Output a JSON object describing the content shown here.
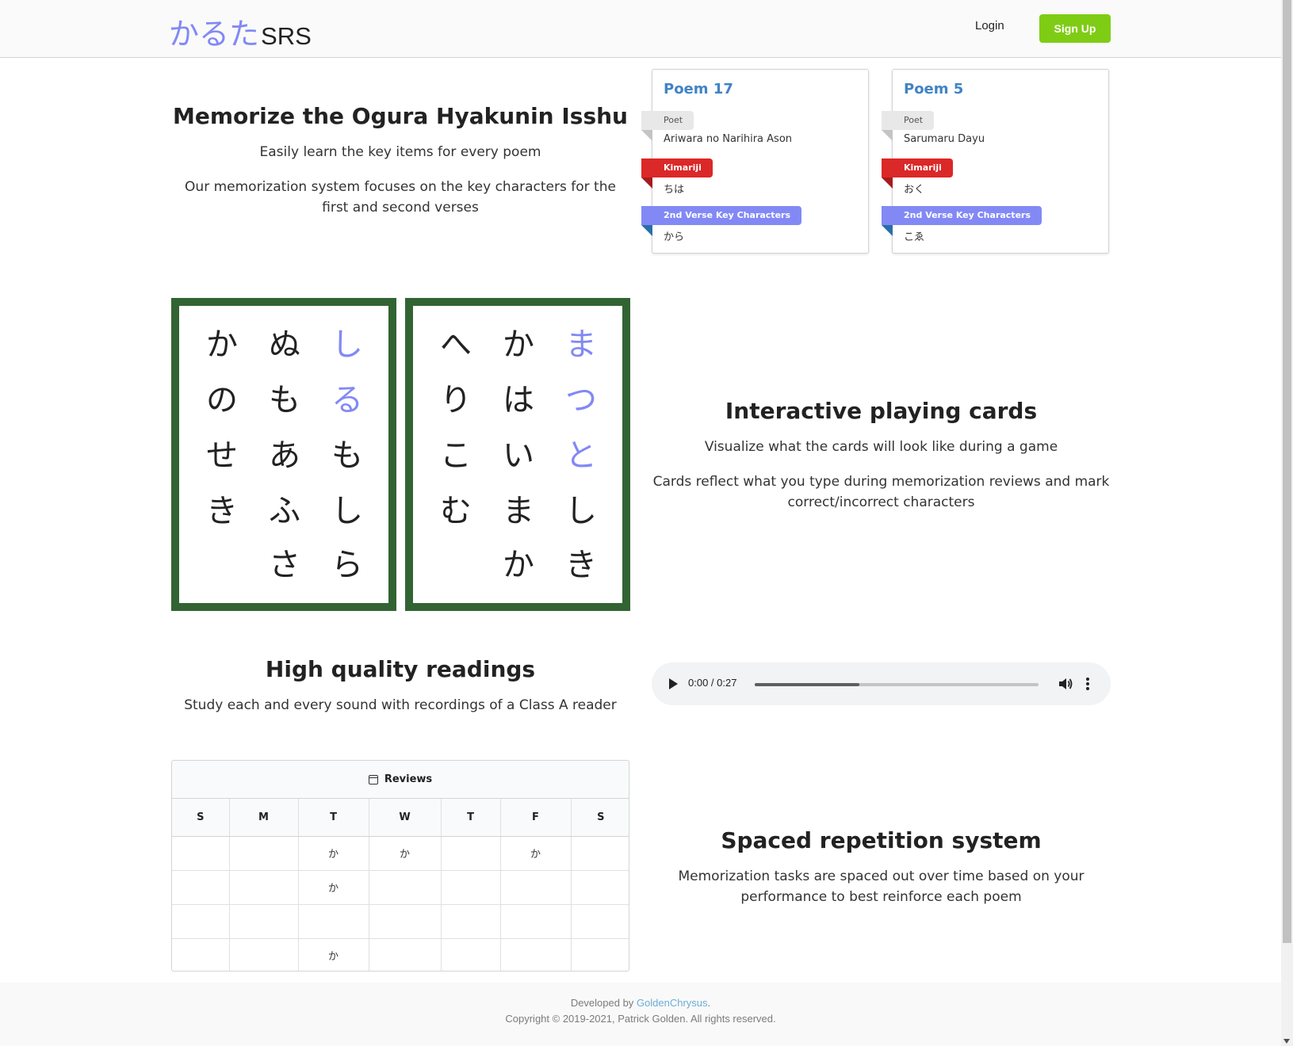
{
  "header": {
    "brand_kana": "かるた",
    "brand_suffix": "SRS",
    "login_label": "Login",
    "signup_label": "Sign Up"
  },
  "hero": {
    "title": "Memorize the Ogura Hyakunin Isshu",
    "subtitle": "Easily learn the key items for every poem",
    "description": "Our memorization system focuses on the key characters for the first and second verses"
  },
  "poem_cards": [
    {
      "title": "Poem 17",
      "poet_label": "Poet",
      "poet": "Ariwara no Narihira Ason",
      "kimariji_label": "Kimariji",
      "kimariji": "ちは",
      "second_label": "2nd Verse Key Characters",
      "second": "から"
    },
    {
      "title": "Poem 5",
      "poet_label": "Poet",
      "poet": "Sarumaru Dayu",
      "kimariji_label": "Kimariji",
      "kimariji": "おく",
      "second_label": "2nd Verse Key Characters",
      "second": "こゑ"
    }
  ],
  "playing_cards": {
    "title": "Interactive playing cards",
    "subtitle": "Visualize what the cards will look like during a game",
    "description": "Cards reflect what you type during memorization reviews and mark correct/incorrect characters",
    "card1": {
      "col1": [
        "か",
        "の",
        "せ",
        "き"
      ],
      "col2": [
        "ぬ",
        "も",
        "あ",
        "ふ",
        "さ"
      ],
      "col3": [
        "し",
        "る",
        "も",
        "し",
        "ら"
      ]
    },
    "card2": {
      "col1": [
        "へ",
        "り",
        "こ",
        "む"
      ],
      "col2": [
        "か",
        "は",
        "い",
        "ま",
        "か"
      ],
      "col3": [
        "ま",
        "つ",
        "と",
        "し",
        "き"
      ]
    },
    "highlight_color": "#8289f5",
    "border_color": "#326433"
  },
  "readings": {
    "title": "High quality readings",
    "subtitle": "Study each and every sound with recordings of a Class A reader",
    "audio_time": "0:00 / 0:27",
    "audio_progress": 0.37
  },
  "srs": {
    "title": "Spaced repetition system",
    "description": "Memorization tasks are spaced out over time based on your performance to best reinforce each poem",
    "calendar_title": "Reviews",
    "days": [
      "S",
      "M",
      "T",
      "W",
      "T",
      "F",
      "S"
    ],
    "rows": [
      [
        "",
        "",
        "か",
        "か",
        "",
        "か",
        ""
      ],
      [
        "",
        "",
        "か",
        "",
        "",
        "",
        ""
      ],
      [
        "",
        "",
        "",
        "",
        "",
        "",
        ""
      ],
      [
        "",
        "",
        "か",
        "",
        "",
        "",
        ""
      ]
    ]
  },
  "footer": {
    "developed_prefix": "Developed by ",
    "developer": "GoldenChrysus",
    "developed_suffix": ".",
    "copyright": "Copyright © 2019-2021, Patrick Golden. All rights reserved."
  },
  "colors": {
    "accent": "#8289f5",
    "signup": "#7fcc14",
    "kimariji": "#db2828",
    "link": "#4183c4"
  }
}
